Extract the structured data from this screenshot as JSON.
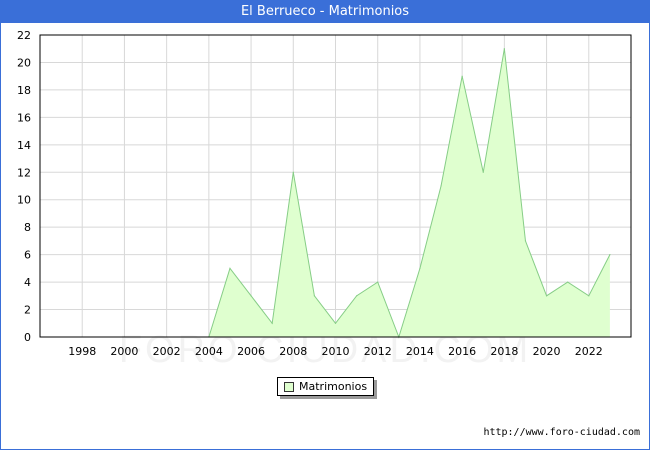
{
  "title": "El Berrueco - Matrimonios",
  "footer": "http://www.foro-ciudad.com",
  "watermark": "FORO-CIUDAD.COM",
  "colors": {
    "header": "#3a6fd8",
    "fill": "#dfffcf",
    "line": "#86cd86",
    "grid": "#d8d8d8"
  },
  "chart_data": {
    "type": "area",
    "title": "El Berrueco - Matrimonios",
    "xlabel": "",
    "ylabel": "",
    "grid": true,
    "legend": "bottom-center",
    "xlim": [
      1996,
      2024
    ],
    "ylim": [
      0,
      22
    ],
    "x_ticks": [
      1998,
      2000,
      2002,
      2004,
      2006,
      2008,
      2010,
      2012,
      2014,
      2016,
      2018,
      2020,
      2022
    ],
    "y_ticks": [
      0,
      2,
      4,
      6,
      8,
      10,
      12,
      14,
      16,
      18,
      20,
      22
    ],
    "series": [
      {
        "name": "Matrimonios",
        "x": [
          2004,
          2005,
          2006,
          2007,
          2008,
          2009,
          2010,
          2011,
          2012,
          2013,
          2014,
          2015,
          2016,
          2017,
          2018,
          2019,
          2020,
          2021,
          2022,
          2023
        ],
        "values": [
          0,
          5,
          3,
          1,
          12,
          3,
          1,
          3,
          4,
          0,
          5,
          11,
          19,
          12,
          21,
          7,
          3,
          4,
          3,
          6
        ]
      }
    ]
  }
}
